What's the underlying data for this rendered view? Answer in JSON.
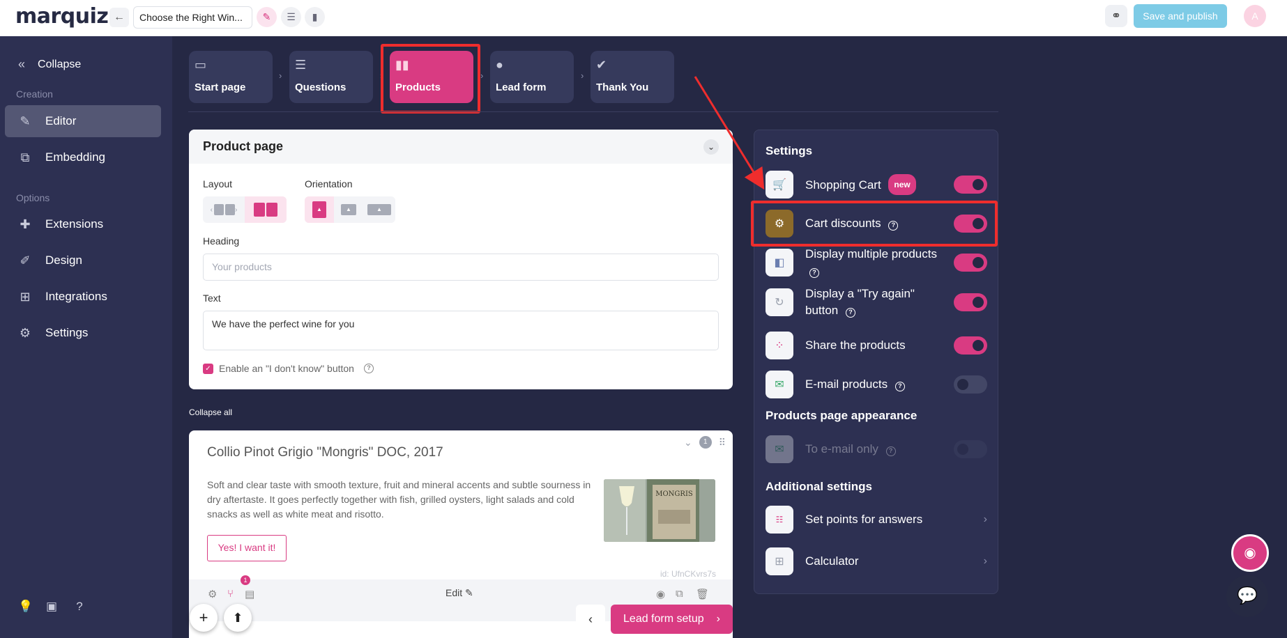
{
  "topbar": {
    "logo": "marquiz",
    "quiz_title": "Choose the Right Win...",
    "publish_label": "Save and publish",
    "avatar_letter": "A"
  },
  "sidebar": {
    "collapse_label": "Collapse",
    "creation_section": "Creation",
    "options_section": "Options",
    "items": [
      {
        "label": "Editor"
      },
      {
        "label": "Embedding"
      },
      {
        "label": "Extensions"
      },
      {
        "label": "Design"
      },
      {
        "label": "Integrations"
      },
      {
        "label": "Settings"
      }
    ]
  },
  "steps": [
    {
      "label": "Start page"
    },
    {
      "label": "Questions"
    },
    {
      "label": "Products"
    },
    {
      "label": "Lead form"
    },
    {
      "label": "Thank You"
    }
  ],
  "product_page": {
    "title": "Product page",
    "layout_label": "Layout",
    "orientation_label": "Orientation",
    "heading_label": "Heading",
    "heading_placeholder": "Your products",
    "text_label": "Text",
    "text_value": "We have the perfect wine for you",
    "dont_know_label": "Enable an \"I don't know\" button"
  },
  "collapse_all": "Collapse all",
  "product": {
    "title": "Collio Pinot Grigio \"Mongris\" DOC, 2017",
    "description": "Soft and clear taste with smooth texture, fruit and mineral accents and subtle sourness in dry aftertaste. It goes perfectly together with fish, grilled oysters, light salads and cold snacks as well as white meat and risotto.",
    "button_label": "Yes! I want it!",
    "id_text": "id: UfnCKvrs7s",
    "index": "1",
    "edit_label": "Edit",
    "branch_count": "1",
    "image_label": "MONGRIS"
  },
  "nav": {
    "next_label": "Lead form setup"
  },
  "settings": {
    "title": "Settings",
    "items": [
      {
        "label": "Shopping Cart",
        "badge": "new",
        "on": true
      },
      {
        "label": "Cart discounts",
        "on": true
      },
      {
        "label": "Display multiple products",
        "on": true
      },
      {
        "label": "Display a \"Try again\" button",
        "on": true
      },
      {
        "label": "Share the products",
        "on": true
      },
      {
        "label": "E-mail products",
        "on": false
      }
    ],
    "appearance_title": "Products page appearance",
    "appearance_item": "To e-mail only",
    "additional_title": "Additional settings",
    "additional_items": [
      {
        "label": "Set points for answers"
      },
      {
        "label": "Calculator"
      }
    ]
  },
  "colors": {
    "accent": "#d93b82",
    "sidebar_bg": "#2d3052",
    "page_bg": "#252844",
    "highlight": "#ef2d2d",
    "publish_bg": "#7dcbe6"
  }
}
